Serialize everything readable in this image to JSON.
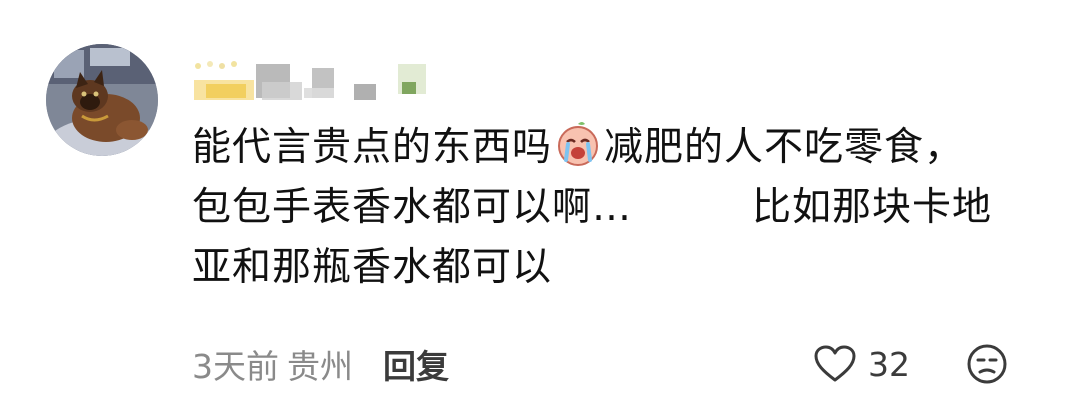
{
  "comment": {
    "avatar_icon": "cat-avatar-icon",
    "username_icon": "blurred-username-icon",
    "text_lines": {
      "line1_part1": "能代言贵点的东西吗",
      "line1_emoji": "crying-face-emoji-icon",
      "line1_part2": "减肥的人不吃零食，",
      "line2_part1": "包包手表香水都可以啊…",
      "line2_part2": "比如那块卡地",
      "line3": "亚和那瓶香水都可以"
    },
    "meta": {
      "time": "3天前",
      "location": "贵州",
      "reply_label": "回复"
    },
    "like": {
      "icon": "heart-icon",
      "count": "32"
    },
    "dislike": {
      "icon": "neutral-face-icon"
    },
    "colors": {
      "text": "#111111",
      "meta": "#8a8a8a",
      "reply": "#3b3b3b",
      "icon": "#3b3b3b"
    }
  }
}
